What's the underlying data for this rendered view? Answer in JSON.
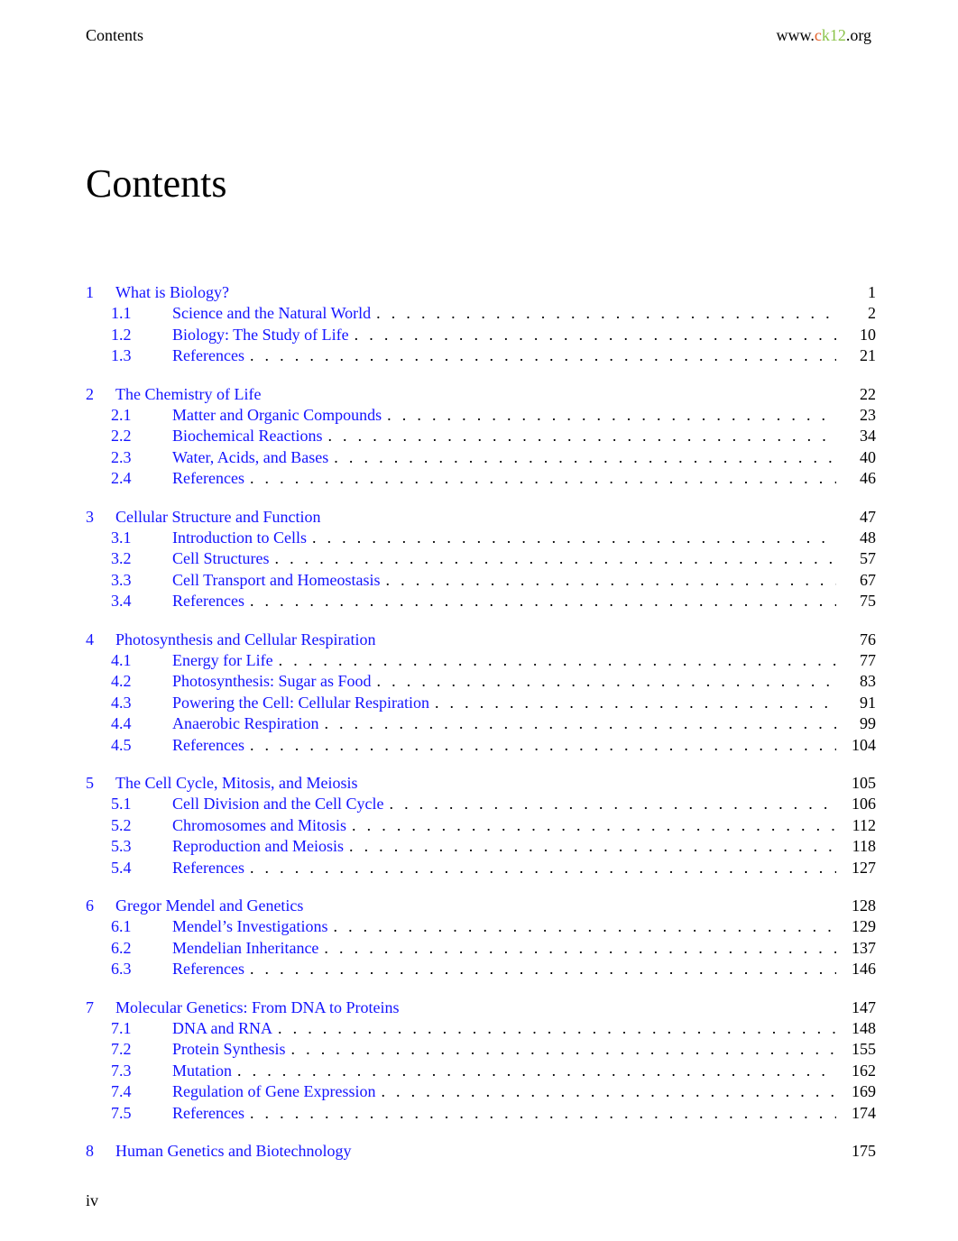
{
  "header": {
    "running_title": "Contents",
    "url_prefix": "www.",
    "url_c": "c",
    "url_k12": "k12",
    "url_suffix": ".org"
  },
  "page_title": "Contents",
  "colors": {
    "link": "#1414ff",
    "ck12_c": "#e2612a",
    "ck12_k12": "#8bc34a"
  },
  "chapters": [
    {
      "num": "1",
      "title": "What is Biology?",
      "page": "1",
      "sections": [
        {
          "num": "1.1",
          "title": "Science and the Natural World",
          "page": "2"
        },
        {
          "num": "1.2",
          "title": "Biology: The Study of Life",
          "page": "10"
        },
        {
          "num": "1.3",
          "title": "References",
          "page": "21"
        }
      ]
    },
    {
      "num": "2",
      "title": "The Chemistry of Life",
      "page": "22",
      "sections": [
        {
          "num": "2.1",
          "title": "Matter and Organic Compounds",
          "page": "23"
        },
        {
          "num": "2.2",
          "title": "Biochemical Reactions",
          "page": "34"
        },
        {
          "num": "2.3",
          "title": "Water, Acids, and Bases",
          "page": "40"
        },
        {
          "num": "2.4",
          "title": "References",
          "page": "46"
        }
      ]
    },
    {
      "num": "3",
      "title": "Cellular Structure and Function",
      "page": "47",
      "sections": [
        {
          "num": "3.1",
          "title": "Introduction to Cells",
          "page": "48"
        },
        {
          "num": "3.2",
          "title": "Cell Structures",
          "page": "57"
        },
        {
          "num": "3.3",
          "title": "Cell Transport and Homeostasis",
          "page": "67"
        },
        {
          "num": "3.4",
          "title": "References",
          "page": "75"
        }
      ]
    },
    {
      "num": "4",
      "title": "Photosynthesis and Cellular Respiration",
      "page": "76",
      "sections": [
        {
          "num": "4.1",
          "title": "Energy for Life",
          "page": "77"
        },
        {
          "num": "4.2",
          "title": "Photosynthesis: Sugar as Food",
          "page": "83"
        },
        {
          "num": "4.3",
          "title": "Powering the Cell: Cellular Respiration",
          "page": "91"
        },
        {
          "num": "4.4",
          "title": "Anaerobic Respiration",
          "page": "99"
        },
        {
          "num": "4.5",
          "title": "References",
          "page": "104"
        }
      ]
    },
    {
      "num": "5",
      "title": "The Cell Cycle, Mitosis, and Meiosis",
      "page": "105",
      "sections": [
        {
          "num": "5.1",
          "title": "Cell Division and the Cell Cycle",
          "page": "106"
        },
        {
          "num": "5.2",
          "title": "Chromosomes and Mitosis",
          "page": "112"
        },
        {
          "num": "5.3",
          "title": "Reproduction and Meiosis",
          "page": "118"
        },
        {
          "num": "5.4",
          "title": "References",
          "page": "127"
        }
      ]
    },
    {
      "num": "6",
      "title": "Gregor Mendel and Genetics",
      "page": "128",
      "sections": [
        {
          "num": "6.1",
          "title": "Mendel’s Investigations",
          "page": "129"
        },
        {
          "num": "6.2",
          "title": "Mendelian Inheritance",
          "page": "137"
        },
        {
          "num": "6.3",
          "title": "References",
          "page": "146"
        }
      ]
    },
    {
      "num": "7",
      "title": "Molecular Genetics: From DNA to Proteins",
      "page": "147",
      "sections": [
        {
          "num": "7.1",
          "title": "DNA and RNA",
          "page": "148"
        },
        {
          "num": "7.2",
          "title": "Protein Synthesis",
          "page": "155"
        },
        {
          "num": "7.3",
          "title": "Mutation",
          "page": "162"
        },
        {
          "num": "7.4",
          "title": "Regulation of Gene Expression",
          "page": "169"
        },
        {
          "num": "7.5",
          "title": "References",
          "page": "174"
        }
      ]
    },
    {
      "num": "8",
      "title": "Human Genetics and Biotechnology",
      "page": "175",
      "sections": []
    }
  ],
  "footer": {
    "folio": "iv"
  }
}
